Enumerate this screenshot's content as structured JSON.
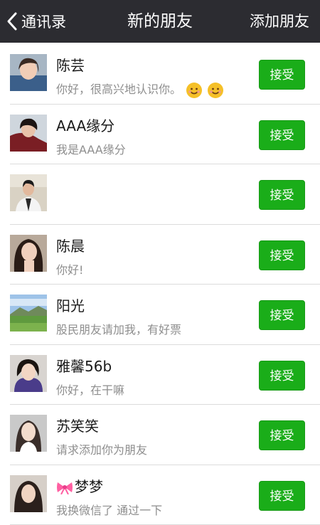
{
  "nav": {
    "back_label": "通讯录",
    "title": "新的朋友",
    "action_label": "添加朋友"
  },
  "colors": {
    "navbar": "#2c2c31",
    "accent_green": "#1aad19",
    "divider": "#dcdcdc"
  },
  "contacts": [
    {
      "name": "陈芸",
      "message": "你好，很高兴地认识你。",
      "button": "接受",
      "emoji": [
        "smile-emoji",
        "smile-emoji"
      ]
    },
    {
      "name": "AAA缘分",
      "message": "我是AAA缘分",
      "button": "接受"
    },
    {
      "name": "",
      "message": "",
      "button": "接受"
    },
    {
      "name": "陈晨",
      "message": "你好!",
      "button": "接受"
    },
    {
      "name": "阳光",
      "message": "股民朋友请加我，有好票",
      "button": "接受"
    },
    {
      "name": "雅馨56b",
      "message": "你好，在干嘛",
      "button": "接受"
    },
    {
      "name": "苏笑笑",
      "message": "请求添加你为朋友",
      "button": "接受"
    },
    {
      "name": "梦梦",
      "message": "我换微信了 通过一下",
      "button": "接受",
      "name_prefix_icon": "pink-bow-icon"
    }
  ]
}
